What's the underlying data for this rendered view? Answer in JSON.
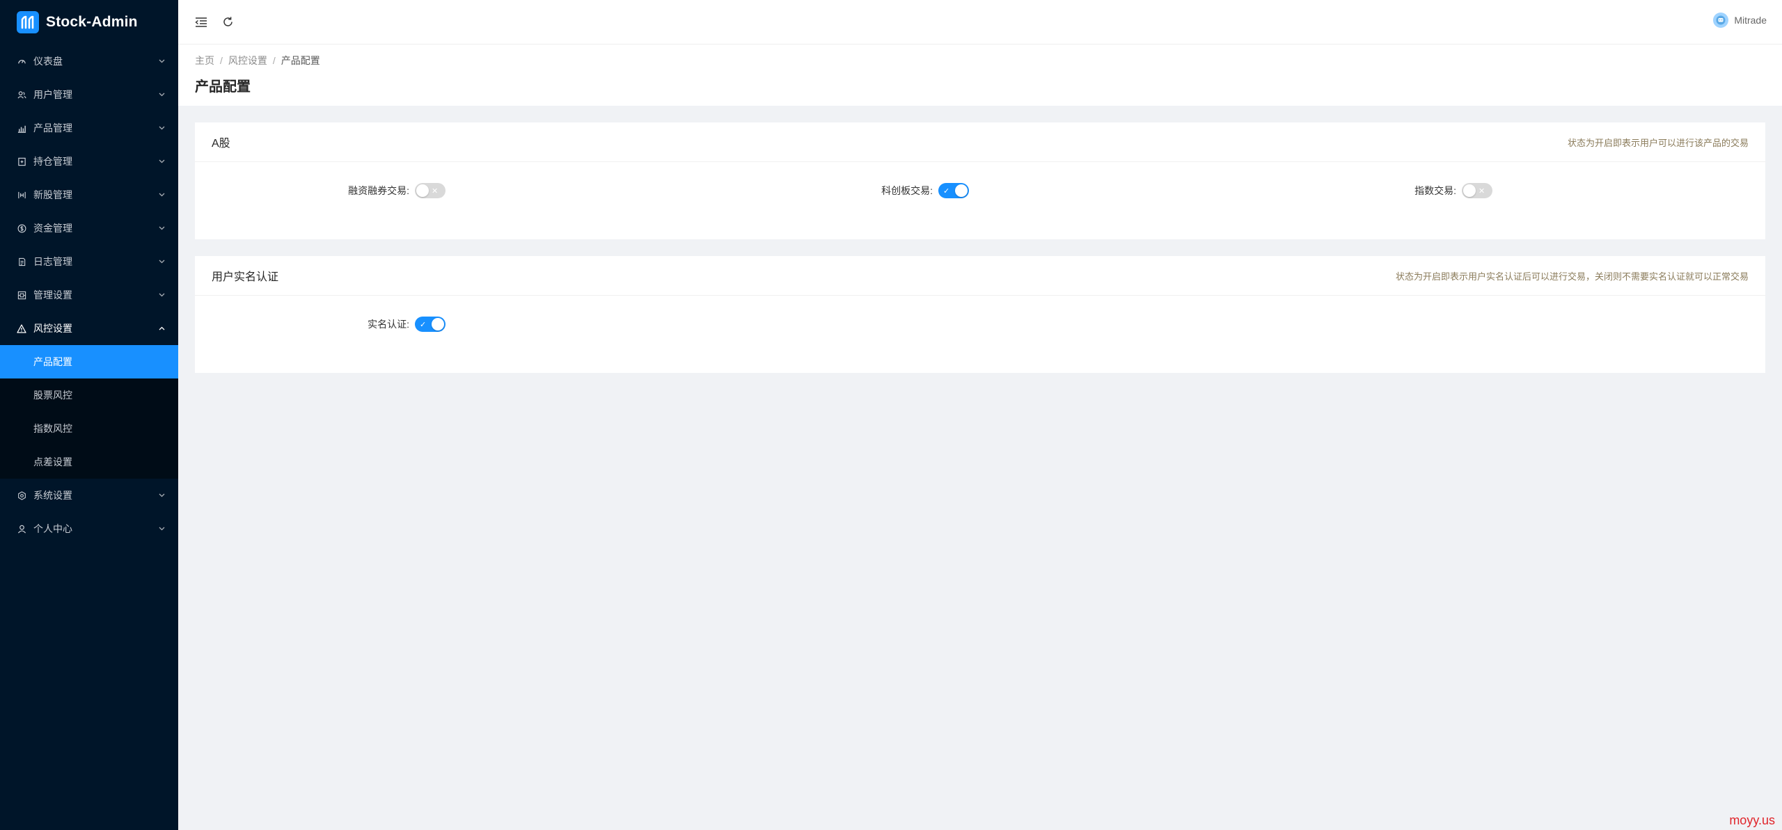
{
  "app": {
    "title": "Stock-Admin",
    "brand_color": "#1890ff",
    "sidebar_bg": "#001529"
  },
  "sidebar": {
    "items": [
      {
        "label": "仪表盘",
        "icon": "dashboard-icon"
      },
      {
        "label": "用户管理",
        "icon": "users-icon"
      },
      {
        "label": "产品管理",
        "icon": "bar-chart-icon"
      },
      {
        "label": "持仓管理",
        "icon": "holdings-icon"
      },
      {
        "label": "新股管理",
        "icon": "ipo-icon"
      },
      {
        "label": "资金管理",
        "icon": "money-icon"
      },
      {
        "label": "日志管理",
        "icon": "log-icon"
      },
      {
        "label": "管理设置",
        "icon": "admin-settings-icon"
      },
      {
        "label": "风控设置",
        "icon": "warning-icon"
      },
      {
        "label": "系统设置",
        "icon": "gear-icon"
      },
      {
        "label": "个人中心",
        "icon": "user-icon"
      }
    ],
    "risk_sub": [
      {
        "label": "产品配置"
      },
      {
        "label": "股票风控"
      },
      {
        "label": "指数风控"
      },
      {
        "label": "点差设置"
      }
    ]
  },
  "header": {
    "username": "Mitrade"
  },
  "breadcrumb": {
    "home": "主页",
    "section": "风控设置",
    "current": "产品配置",
    "sep": "/"
  },
  "page": {
    "title": "产品配置"
  },
  "card_a": {
    "title": "A股",
    "extra": "状态为开启即表示用户可以进行该产品的交易",
    "fields": [
      {
        "label": "融资融券交易:",
        "on": false
      },
      {
        "label": "科创板交易:",
        "on": true
      },
      {
        "label": "指数交易:",
        "on": false
      }
    ]
  },
  "card_auth": {
    "title": "用户实名认证",
    "extra": "状态为开启即表示用户实名认证后可以进行交易，关闭则不需要实名认证就可以正常交易",
    "fields": [
      {
        "label": "实名认证:",
        "on": true
      }
    ]
  },
  "switch_marks": {
    "on": "✓",
    "off": "✕"
  },
  "watermark": "moyy.us"
}
